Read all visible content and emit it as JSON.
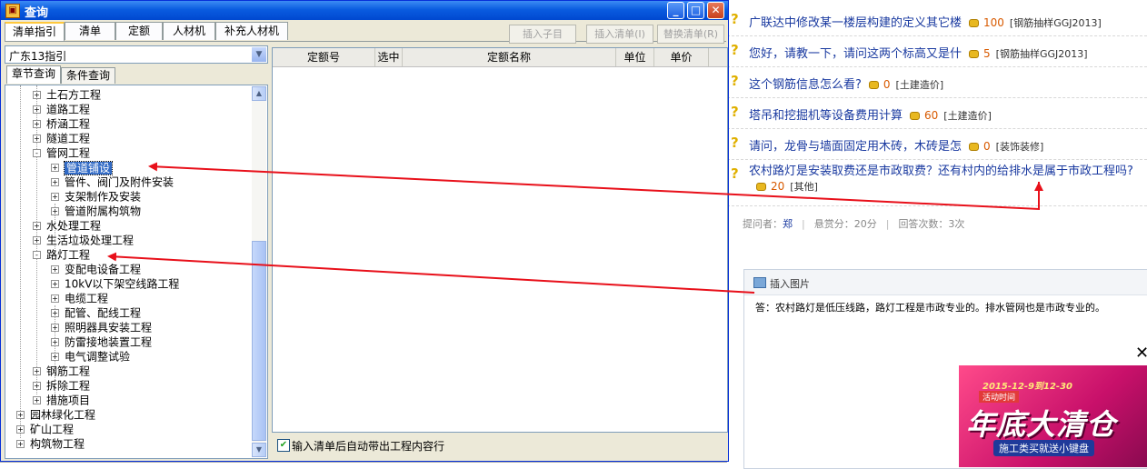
{
  "window": {
    "title": "查询",
    "tabs": [
      "清单指引",
      "清单",
      "定额",
      "人材机",
      "补充人材机"
    ],
    "toolbar": {
      "insert_child": "插入子目",
      "insert_list": "插入清单(I)",
      "replace_list": "替换清单(R)"
    },
    "combo_value": "广东13指引",
    "subtabs": [
      "章节查询",
      "条件查询"
    ],
    "tree": [
      {
        "label": "土石方工程",
        "level": 1,
        "box": "+"
      },
      {
        "label": "道路工程",
        "level": 1,
        "box": "+"
      },
      {
        "label": "桥涵工程",
        "level": 1,
        "box": "+"
      },
      {
        "label": "隧道工程",
        "level": 1,
        "box": "+"
      },
      {
        "label": "管网工程",
        "level": 1,
        "box": "-"
      },
      {
        "label": "管道铺设",
        "level": 2,
        "box": "+",
        "selected": true
      },
      {
        "label": "管件、阀门及附件安装",
        "level": 2,
        "box": "+"
      },
      {
        "label": "支架制作及安装",
        "level": 2,
        "box": "+"
      },
      {
        "label": "管道附属构筑物",
        "level": 2,
        "box": "+"
      },
      {
        "label": "水处理工程",
        "level": 1,
        "box": "+"
      },
      {
        "label": "生活垃圾处理工程",
        "level": 1,
        "box": "+"
      },
      {
        "label": "路灯工程",
        "level": 1,
        "box": "-"
      },
      {
        "label": "变配电设备工程",
        "level": 2,
        "box": "+"
      },
      {
        "label": "10kV以下架空线路工程",
        "level": 2,
        "box": "+"
      },
      {
        "label": "电缆工程",
        "level": 2,
        "box": "+"
      },
      {
        "label": "配管、配线工程",
        "level": 2,
        "box": "+"
      },
      {
        "label": "照明器具安装工程",
        "level": 2,
        "box": "+"
      },
      {
        "label": "防雷接地装置工程",
        "level": 2,
        "box": "+"
      },
      {
        "label": "电气调整试验",
        "level": 2,
        "box": "+"
      },
      {
        "label": "钢筋工程",
        "level": 1,
        "box": "+"
      },
      {
        "label": "拆除工程",
        "level": 1,
        "box": "+"
      },
      {
        "label": "措施项目",
        "level": 1,
        "box": "+"
      },
      {
        "label": "园林绿化工程",
        "level": 0,
        "box": "+"
      },
      {
        "label": "矿山工程",
        "level": 0,
        "box": "+"
      },
      {
        "label": "构筑物工程",
        "level": 0,
        "box": "+"
      }
    ],
    "grid_columns": [
      "定额号",
      "选中",
      "定额名称",
      "单位",
      "单价"
    ],
    "checkbox_label": "输入清单后自动带出工程内容行",
    "checkbox_checked": true
  },
  "qa": {
    "questions": [
      {
        "text": "广联达中修改某一楼层构建的定义其它楼",
        "points": "100",
        "tag": "[钢筋抽样GGJ2013]"
      },
      {
        "text": "您好，请教一下，请问这两个标高又是什",
        "points": "5",
        "tag": "[钢筋抽样GGJ2013]"
      },
      {
        "text": "这个钢筋信息怎么看?",
        "points": "0",
        "tag": "[土建造价]"
      },
      {
        "text": "塔吊和挖掘机等设备费用计算",
        "points": "60",
        "tag": "[土建造价]"
      },
      {
        "text": "请问，龙骨与墙面固定用木砖，木砖是怎",
        "points": "0",
        "tag": "[装饰装修]"
      },
      {
        "text": "农村路灯是安装取费还是市政取费？还有村内的给排水是属于市政工程吗?",
        "points": "20",
        "tag": "[其他]"
      }
    ],
    "meta": {
      "asker_label": "提问者：",
      "asker": "郑",
      "reward": "悬赏分：20分",
      "answers": "回答次数：3次"
    },
    "insert_image": "插入图片",
    "answer": "答：农村路灯是低压线路，路灯工程是市政专业的。排水管网也是市政专业的。"
  },
  "ad": {
    "date": "2015-12-9到12-30",
    "sub": "活动时间",
    "title": "年底大清仓",
    "slogan": "施工类买就送小键盘"
  },
  "colors": {
    "arrow": "#e8101a",
    "title_bar": "#0a5ce0",
    "link": "#1a3aa0",
    "points": "#d85a00"
  }
}
